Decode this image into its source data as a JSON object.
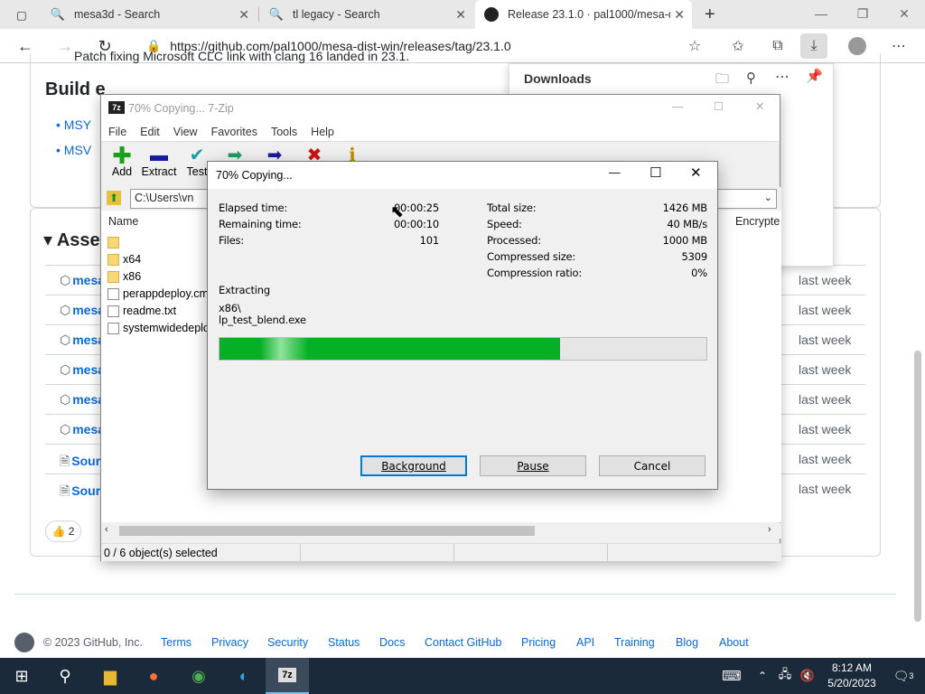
{
  "browser": {
    "tabs": [
      {
        "title": "mesa3d - Search"
      },
      {
        "title": "tl legacy - Search"
      },
      {
        "title": "Release 23.1.0 · pal1000/mesa-d"
      }
    ],
    "url": "https://github.com/pal1000/mesa-dist-win/releases/tag/23.1.0"
  },
  "page": {
    "partial_bullet": "Patch fixing Microsoft CLC link with clang 16 landed in 23.1.",
    "build_heading": "Build e",
    "bullets": [
      "MSY",
      "MSV"
    ],
    "assets_heading": "Asset",
    "assets": [
      {
        "name": "mesa",
        "date": "last week"
      },
      {
        "name": "mesa",
        "date": "last week"
      },
      {
        "name": "mesa",
        "date": "last week"
      },
      {
        "name": "mesa",
        "date": "last week"
      },
      {
        "name": "mesa",
        "date": "last week"
      },
      {
        "name": "mesa",
        "date": "last week"
      },
      {
        "name": "Sour",
        "date": "last week"
      },
      {
        "name": "Sour",
        "date": "last week"
      }
    ],
    "reaction_count": "2",
    "footer": {
      "copyright": "© 2023 GitHub, Inc.",
      "links": [
        "Terms",
        "Privacy",
        "Security",
        "Status",
        "Docs",
        "Contact GitHub",
        "Pricing",
        "API",
        "Training",
        "Blog",
        "About"
      ]
    }
  },
  "downloads": {
    "title": "Downloads"
  },
  "sevenzip": {
    "title": "70% Copying... 7-Zip",
    "menu": [
      "File",
      "Edit",
      "View",
      "Favorites",
      "Tools",
      "Help"
    ],
    "toolbar": [
      "Add",
      "Extract",
      "Test"
    ],
    "path": "C:\\Users\\vn",
    "column_name": "Name",
    "column_encrypted": "Encrypte",
    "files": [
      {
        "name": "",
        "type": "folder"
      },
      {
        "name": "x64",
        "type": "folder"
      },
      {
        "name": "x86",
        "type": "folder"
      },
      {
        "name": "perappdeploy.cm",
        "type": "file"
      },
      {
        "name": "readme.txt",
        "type": "file"
      },
      {
        "name": "systemwidedeplo",
        "type": "file"
      }
    ],
    "status": "0 / 6 object(s) selected"
  },
  "progress": {
    "title": "70% Copying...",
    "elapsed_label": "Elapsed time:",
    "elapsed": "00:00:25",
    "remaining_label": "Remaining time:",
    "remaining": "00:00:10",
    "files_label": "Files:",
    "files": "101",
    "total_label": "Total size:",
    "total": "1426 MB",
    "speed_label": "Speed:",
    "speed": "40 MB/s",
    "processed_label": "Processed:",
    "processed": "1000 MB",
    "compressed_label": "Compressed size:",
    "compressed": "5309",
    "ratio_label": "Compression ratio:",
    "ratio": "0%",
    "action": "Extracting",
    "current_dir": "x86\\",
    "current_file": "lp_test_blend.exe",
    "percent": 70,
    "buttons": {
      "background": "Background",
      "pause": "Pause",
      "cancel": "Cancel"
    }
  },
  "taskbar": {
    "time": "8:12 AM",
    "date": "5/20/2023",
    "notifications": "3"
  }
}
